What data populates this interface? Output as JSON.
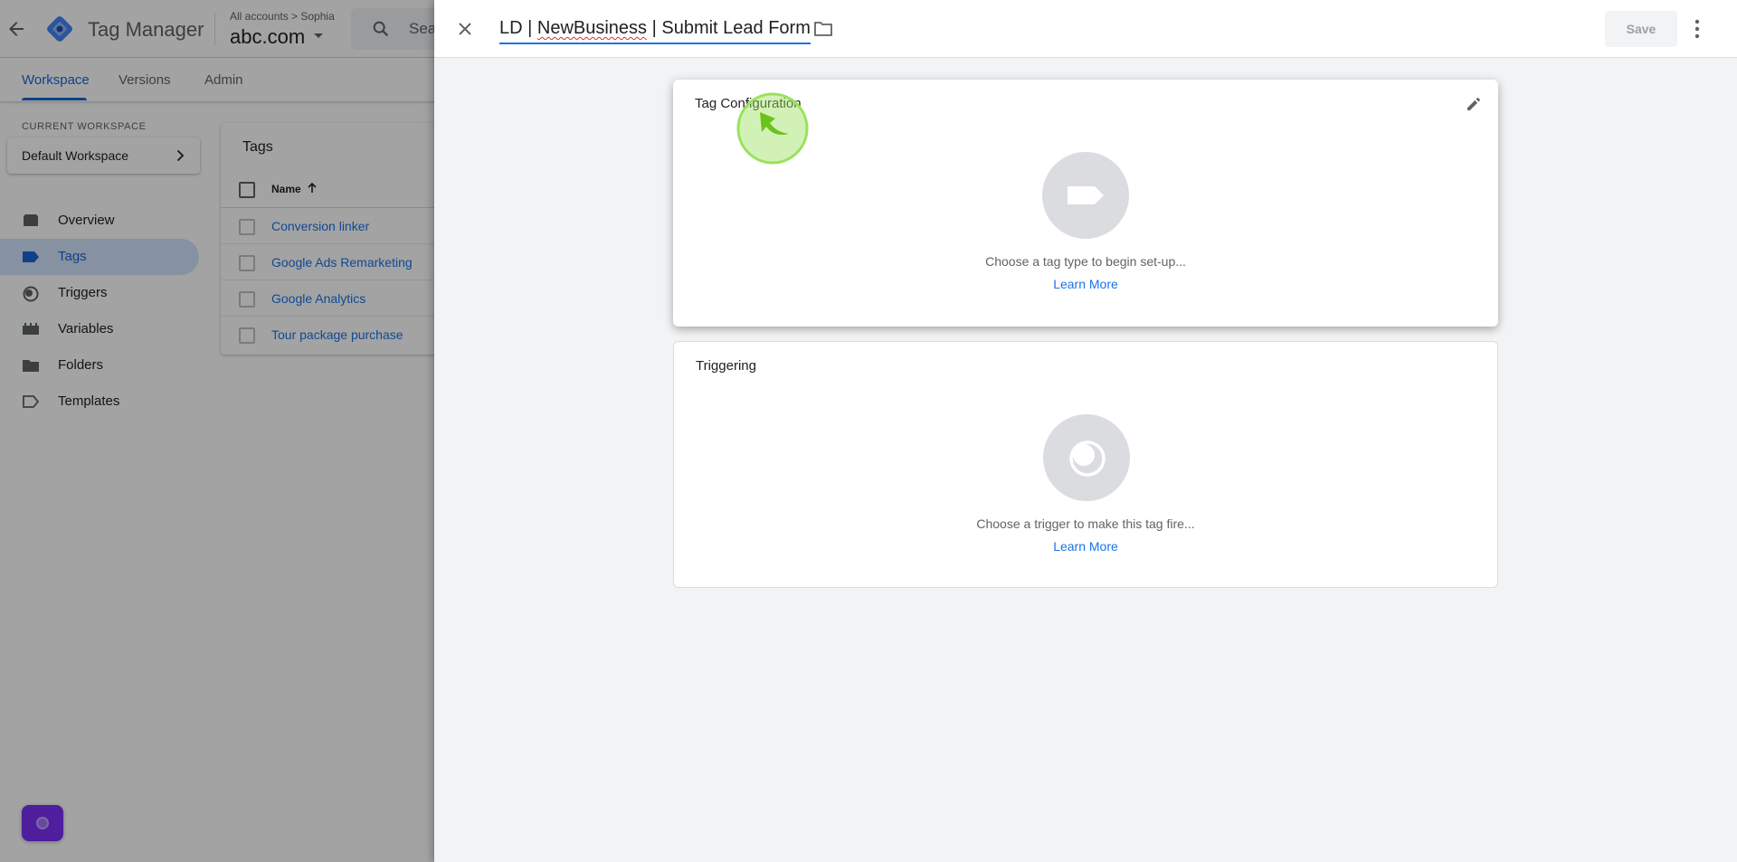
{
  "app": {
    "name": "Tag Manager",
    "account_crumb": "All accounts > Sophia",
    "container": "abc.com",
    "search_placeholder": "Search workspace"
  },
  "nav_tabs": [
    {
      "label": "Workspace",
      "active": true
    },
    {
      "label": "Versions",
      "active": false
    },
    {
      "label": "Admin",
      "active": false
    }
  ],
  "workspace": {
    "label": "CURRENT WORKSPACE",
    "name": "Default Workspace"
  },
  "sidebar": {
    "items": [
      {
        "label": "Overview",
        "icon": "overview-icon"
      },
      {
        "label": "Tags",
        "icon": "tag-icon",
        "active": true
      },
      {
        "label": "Triggers",
        "icon": "trigger-icon"
      },
      {
        "label": "Variables",
        "icon": "variables-icon"
      },
      {
        "label": "Folders",
        "icon": "folder-icon"
      },
      {
        "label": "Templates",
        "icon": "templates-icon"
      }
    ]
  },
  "tags_table": {
    "title": "Tags",
    "column_name": "Name",
    "rows": [
      "Conversion linker",
      "Google Ads Remarketing",
      "Google Analytics",
      "Tour package purchase"
    ]
  },
  "editor": {
    "tag_name_parts": [
      "LD | ",
      "NewBusiness",
      " | Submit Lead Form"
    ],
    "save_label": "Save",
    "config": {
      "title": "Tag Configuration",
      "hint": "Choose a tag type to begin set-up...",
      "learn_more": "Learn More"
    },
    "triggering": {
      "title": "Triggering",
      "hint": "Choose a trigger to make this tag fire...",
      "learn_more": "Learn More"
    }
  },
  "colors": {
    "accent": "#1a73e8",
    "active_nav_bg": "#d2e3fc",
    "fab": "#7b2ff7",
    "pointer_highlight": "#9be15d"
  }
}
